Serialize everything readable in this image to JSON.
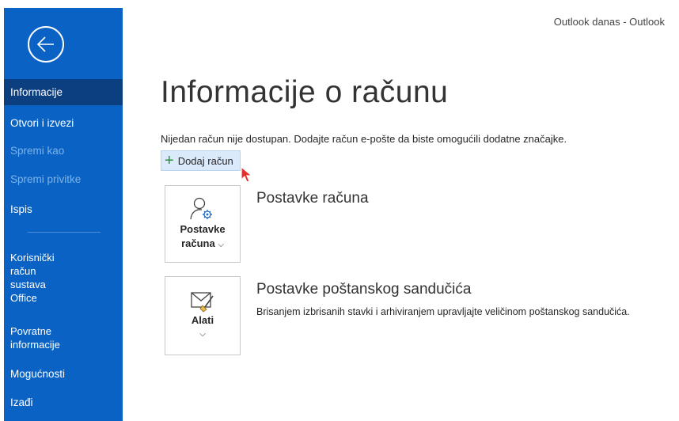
{
  "window": {
    "title": "Outlook danas  -  Outlook"
  },
  "sidebar": {
    "back_icon": "back-arrow-icon",
    "items": [
      {
        "label": "Informacije",
        "state": "active"
      },
      {
        "label": "Otvori i izvezi",
        "state": "normal"
      },
      {
        "label": "Spremi kao",
        "state": "disabled"
      },
      {
        "label": "Spremi privitke",
        "state": "disabled"
      },
      {
        "label": "Ispis",
        "state": "normal"
      },
      {
        "label": "Korisnički račun sustava Office",
        "lines": [
          "Korisnički",
          "račun",
          "sustava",
          "Office"
        ],
        "state": "normal"
      },
      {
        "label": "Povratne informacije",
        "lines": [
          "Povratne",
          "informacije"
        ],
        "state": "normal"
      },
      {
        "label": "Mogućnosti",
        "state": "normal"
      },
      {
        "label": "Izađi",
        "state": "normal"
      }
    ]
  },
  "main": {
    "title": "Informacije o računu",
    "notice": "Nijedan račun nije dostupan. Dodajte račun e-pošte da biste omogućili dodatne značajke.",
    "add_account_label": "Dodaj račun",
    "add_icon": "plus-icon",
    "sections": [
      {
        "tile_lines": [
          "Postavke",
          "računa"
        ],
        "tile_icon": "account-settings-icon",
        "heading": "Postavke računa",
        "description": ""
      },
      {
        "tile_lines": [
          "Alati"
        ],
        "tile_icon": "mailbox-cleanup-icon",
        "heading": "Postavke poštanskog sandučića",
        "description": "Brisanjem izbrisanih stavki i arhiviranjem upravljajte veličinom poštanskog sandučića."
      }
    ]
  },
  "colors": {
    "sidebar_bg": "#0a63c4",
    "sidebar_active": "#0b3f80",
    "sidebar_disabled_text": "#7fb2e8",
    "add_button_bg": "#dbeafa",
    "plus_green": "#2e8b3d"
  }
}
